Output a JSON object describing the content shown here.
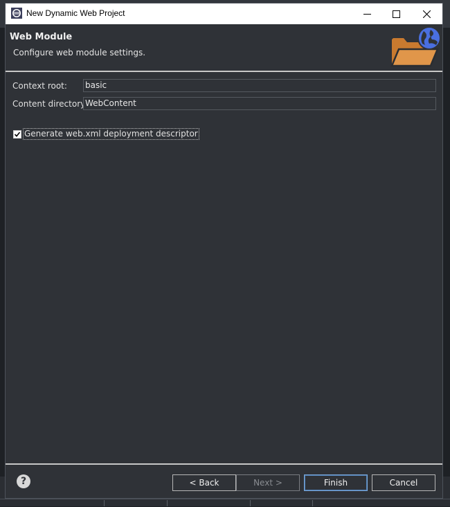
{
  "window": {
    "title": "New Dynamic Web Project"
  },
  "header": {
    "title": "Web Module",
    "subtitle": "Configure web module settings.",
    "icon": "web-project-folder-globe-icon"
  },
  "form": {
    "context_root": {
      "label": "Context root:",
      "value": "basic"
    },
    "content_directory": {
      "label": "Content directory:",
      "value": "WebContent"
    },
    "generate_web_xml": {
      "label": "Generate web.xml deployment descriptor",
      "checked": true
    }
  },
  "buttons": {
    "back": "< Back",
    "next": "Next >",
    "finish": "Finish",
    "cancel": "Cancel",
    "help": "?"
  },
  "colors": {
    "dialog_bg": "#2f3237",
    "folder": "#d98b3a",
    "globe": "#4a6fe0",
    "default_button_border": "#7aa7d8"
  }
}
